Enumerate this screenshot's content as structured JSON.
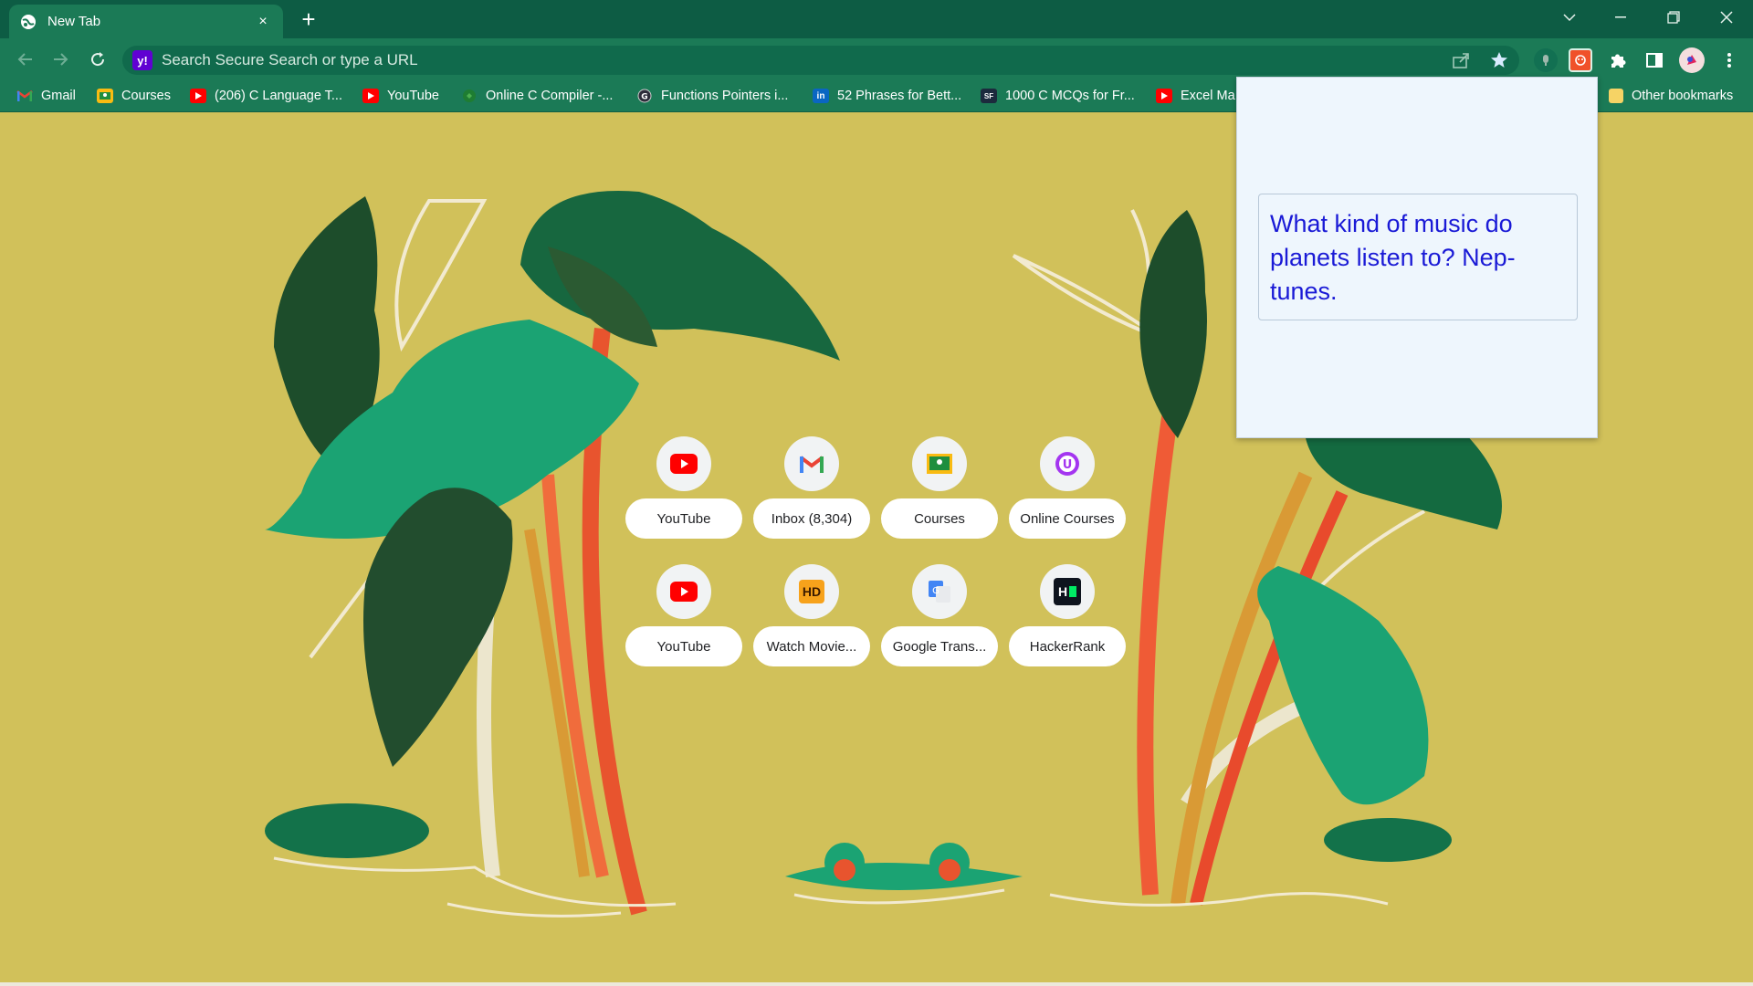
{
  "tab": {
    "title": "New Tab",
    "close": "×"
  },
  "omnibox": {
    "placeholder": "Search Secure Search or type a URL",
    "engine_icon": "y!"
  },
  "bookmarks": [
    {
      "label": "Gmail",
      "icon": "gmail-icon"
    },
    {
      "label": "Courses",
      "icon": "classroom-icon"
    },
    {
      "label": "(206) C Language T...",
      "icon": "youtube-icon"
    },
    {
      "label": "YouTube",
      "icon": "youtube-icon"
    },
    {
      "label": "Online C Compiler -...",
      "icon": "compiler-icon"
    },
    {
      "label": "Functions Pointers i...",
      "icon": "site-icon"
    },
    {
      "label": "52 Phrases for Bett...",
      "icon": "linkedin-icon"
    },
    {
      "label": "1000 C MCQs for Fr...",
      "icon": "sanfoundry-icon"
    },
    {
      "label": "Excel Ma",
      "icon": "youtube-icon"
    }
  ],
  "other_bookmarks": "Other bookmarks",
  "shortcuts": [
    {
      "label": "YouTube",
      "icon": "youtube-icon"
    },
    {
      "label": "Inbox (8,304)",
      "icon": "gmail-icon"
    },
    {
      "label": "Courses",
      "icon": "classroom-icon"
    },
    {
      "label": "Online Courses",
      "icon": "udemy-icon"
    },
    {
      "label": "YouTube",
      "icon": "youtube-icon"
    },
    {
      "label": "Watch Movie...",
      "icon": "hd-icon",
      "icon_text": "HD"
    },
    {
      "label": "Google Trans...",
      "icon": "google-translate-icon"
    },
    {
      "label": "HackerRank",
      "icon": "hackerrank-icon",
      "icon_text": "H"
    }
  ],
  "popup": {
    "joke": "What kind of music do planets listen to? Nep-tunes."
  },
  "colors": {
    "titlebar": "#0d5c44",
    "toolbar": "#1b7a56",
    "background": "#d1c15a",
    "joke_text": "#1a1ad6"
  }
}
